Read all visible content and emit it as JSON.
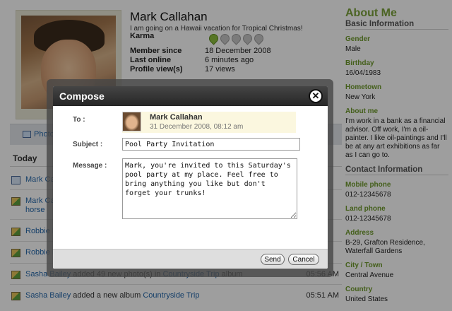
{
  "profile": {
    "name": "Mark Callahan",
    "status": "I am going on a Hawaii vacation for Tropical Christmas!",
    "karma_label": "Karma",
    "karma_icons": [
      true,
      false,
      false,
      false,
      false
    ],
    "member_since_label": "Member since",
    "member_since": "18 December 2008",
    "last_online_label": "Last online",
    "last_online": "6 minutes ago",
    "views_label": "Profile view(s)",
    "views": "17 views"
  },
  "tab": {
    "label": "Photo"
  },
  "feed": {
    "heading": "Today",
    "items": [
      {
        "icon": "calendar-icon",
        "text_fragment": "Mark Ca",
        "time": ""
      },
      {
        "icon": "photo-icon",
        "text_fragment": "Mark Ca",
        "text_fragment2": "horse",
        "time": ""
      },
      {
        "icon": "photo-icon",
        "text_fragment": "Robbie D",
        "time": ""
      },
      {
        "icon": "photo-icon",
        "text_fragment": "Robbie D",
        "time": ""
      },
      {
        "icon": "photo-icon",
        "actor": "Sasha Bailey",
        "action": " added 49 new photo(s) in ",
        "target": "Countryside Trip",
        "suffix": " album",
        "time": "05:56 AM"
      },
      {
        "icon": "photo-icon",
        "actor": "Sasha Bailey",
        "action": " added a new album ",
        "target": "Countryside Trip",
        "suffix": "",
        "time": "05:51 AM"
      }
    ]
  },
  "about": {
    "title": "About Me",
    "basic_heading": "Basic Information",
    "gender_label": "Gender",
    "gender": "Male",
    "birthday_label": "Birthday",
    "birthday": "16/04/1983",
    "hometown_label": "Hometown",
    "hometown": "New York",
    "aboutme_label": "About me",
    "aboutme": "I'm work in a bank as a financial advisor. Off work, I'm a oil-painter. I like oil-paintings and I'll be at any art exhibitions as far as I can go to.",
    "contact_heading": "Contact Information",
    "mobile_label": "Mobile phone",
    "mobile": "012-12345678",
    "land_label": "Land phone",
    "land": "012-12345678",
    "address_label": "Address",
    "address": "B-29, Grafton Residence, Waterfall Gardens",
    "city_label": "City / Town",
    "city": "Central Avenue",
    "country_label": "Country",
    "country": "United States"
  },
  "compose": {
    "title": "Compose",
    "to_label": "To :",
    "to_name": "Mark Callahan",
    "to_date": "31 December 2008, 08:12 am",
    "subject_label": "Subject :",
    "subject_value": "Pool Party Invitation",
    "message_label": "Message :",
    "message_value": "Mark, you're invited to this Saturday's pool party at my place. Feel free to bring anything you like but don't forget your trunks!",
    "send_label": "Send",
    "cancel_label": "Cancel"
  },
  "colors": {
    "accent_green": "#7ba23a",
    "link_blue": "#2266aa",
    "modal_header": "#2e2e2e"
  }
}
